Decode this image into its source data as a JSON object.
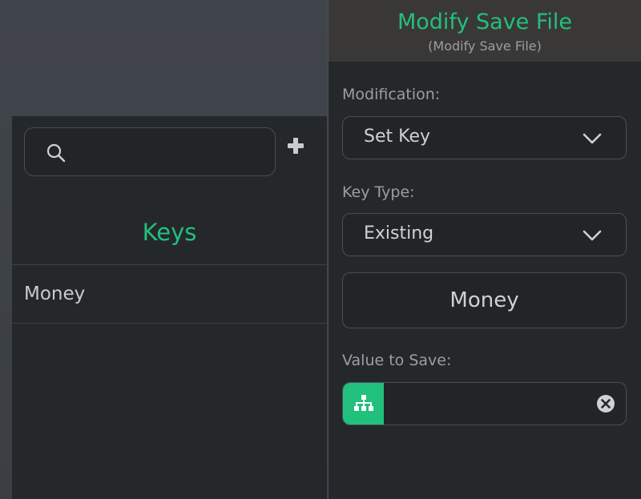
{
  "keys_panel": {
    "search": {
      "value": "",
      "placeholder": ""
    },
    "title": "Keys",
    "items": [
      {
        "label": "Money"
      }
    ]
  },
  "modify_panel": {
    "title": "Modify Save File",
    "subtitle": "(Modify Save File)",
    "modification_label": "Modification:",
    "modification_value": "Set Key",
    "key_type_label": "Key Type:",
    "key_type_value": "Existing",
    "selected_key": "Money",
    "value_label": "Value to Save:",
    "value_input": ""
  },
  "colors": {
    "accent": "#22c07d",
    "panel_bg": "#25282b",
    "header_bg": "#3a3837",
    "border": "#4a4e53",
    "text": "#cfd2d5",
    "muted_text": "#9a9ea2"
  },
  "icons": [
    "search-icon",
    "add-icon",
    "chevron-down-icon",
    "hierarchy-icon",
    "clear-icon"
  ]
}
